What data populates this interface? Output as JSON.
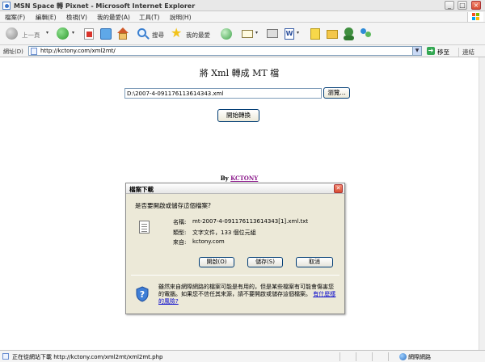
{
  "window": {
    "title": "MSN Space 轉 Pixnet - Microsoft Internet Explorer",
    "controls": {
      "minimize": "_",
      "maximize": "□",
      "close": "×"
    }
  },
  "menu": {
    "items": [
      "檔案(F)",
      "編輯(E)",
      "檢視(V)",
      "我的最愛(A)",
      "工具(T)",
      "說明(H)"
    ]
  },
  "toolbar": {
    "back_label": "上一頁",
    "search_label": "搜尋",
    "favorites_label": "我的最愛",
    "icons": [
      "back-icon",
      "forward-icon",
      "stop-icon",
      "refresh-icon",
      "home-icon",
      "search-icon",
      "favorites-star-icon",
      "history-icon",
      "mail-icon",
      "print-icon",
      "edit-icon",
      "folder-icon",
      "messenger-icon"
    ]
  },
  "address": {
    "label": "網址(D)",
    "url": "http://kctony.com/xml2mt/",
    "go_label": "移至",
    "links_label": "連結"
  },
  "page": {
    "title": "將 Xml 轉成 MT 檔",
    "file_path": "D:\\2007-4-091176113614343.xml",
    "browse_label": "瀏覽...",
    "convert_label": "開始轉換",
    "by_prefix": "By",
    "by_link": "KCTONY"
  },
  "dialog": {
    "title": "檔案下載",
    "question": "是否要開啟或儲存這個檔案?",
    "info": [
      {
        "key": "名稱:",
        "value": "mt-2007-4-091176113614343[1].xml.txt"
      },
      {
        "key": "類型:",
        "value": "文字文件，133 個位元組"
      },
      {
        "key": "來自:",
        "value": "kctony.com"
      }
    ],
    "open_label": "開啟(O)",
    "save_label": "儲存(S)",
    "cancel_label": "取消",
    "warning_text": "雖然來自網際網路的檔案可能是有用的，但是某些檔案有可能會傷害您的電腦。如果您不信任其來源，請不要開啟或儲存這個檔案。",
    "help_link": "有什麼樣的風險?"
  },
  "status": {
    "text": "正在從網站下載 http://kctony.com/xml2mt/xml2mt.php",
    "zone": "網際網路"
  },
  "colors": {
    "link_visited": "#8b1a8b",
    "help_link": "#0000cc",
    "dialog_bg": "#ece9d8"
  }
}
